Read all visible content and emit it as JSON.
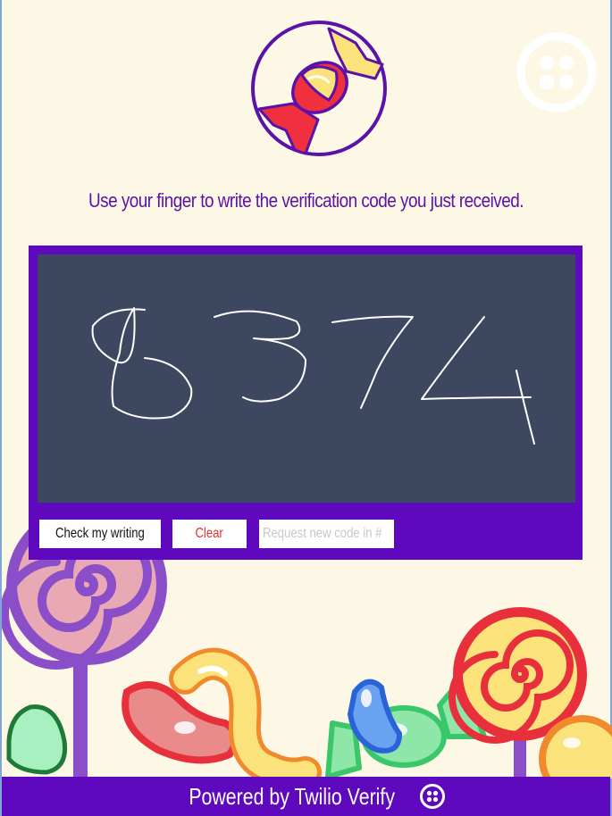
{
  "instruction": "Use your finger to write the verification code you just received.",
  "handwriting": "8374",
  "buttons": {
    "check": "Check my writing",
    "clear": "Clear",
    "request": "Request new code in #"
  },
  "footer": {
    "text": "Powered by Twilio Verify"
  },
  "icons": [
    "candy-logo-icon",
    "twilio-logo-icon"
  ],
  "colors": {
    "background": "#fdf8e6",
    "accent": "#5e09bd",
    "canvas": "#3d475f",
    "clear_text": "#e0302c"
  }
}
